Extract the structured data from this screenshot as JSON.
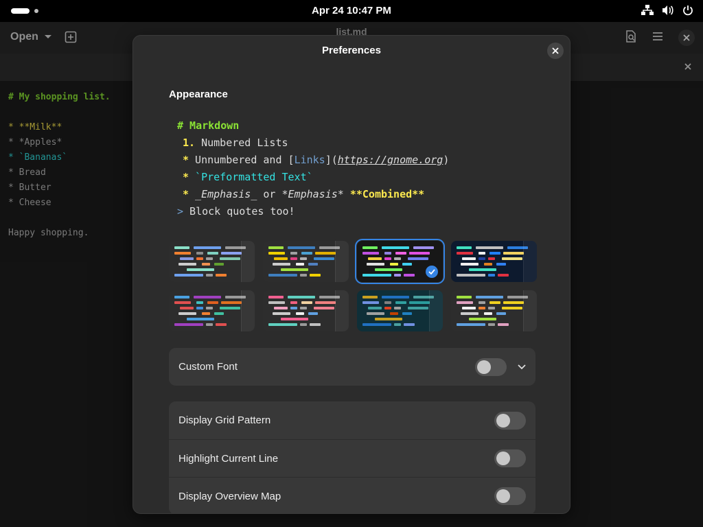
{
  "topbar": {
    "clock": "Apr 24  10:47 PM",
    "tray_icons": [
      "network-icon",
      "volume-icon",
      "power-icon"
    ]
  },
  "window": {
    "title": "list.md",
    "open_label": "Open"
  },
  "editor": {
    "lines": [
      {
        "text": "# My shopping list.",
        "color": "#8ae234",
        "bold": true
      },
      {
        "text": "",
        "color": "#ccc"
      },
      {
        "text": "* **Milk**",
        "color": "#fce94f"
      },
      {
        "text": "* *Apples*",
        "color": "#bbb"
      },
      {
        "text": "* `Bananas`",
        "color": "#34e2e2"
      },
      {
        "text": "* Bread",
        "color": "#bbb"
      },
      {
        "text": "* Butter",
        "color": "#bbb"
      },
      {
        "text": "* Cheese",
        "color": "#bbb"
      },
      {
        "text": "",
        "color": "#ccc"
      },
      {
        "text": "Happy shopping.",
        "color": "#bbb"
      }
    ]
  },
  "dialog": {
    "title": "Preferences",
    "section_appearance": "Appearance",
    "preview": {
      "l1_a": "# Markdown",
      "l2_num": "1.",
      "l2_text": " Numbered Lists",
      "l3_star": "*",
      "l3_a": " Unnumbered and ",
      "l3_b": "[",
      "l3_c": "Links",
      "l3_d": "](",
      "l3_e": "https://gnome.org",
      "l3_f": ")",
      "l4_star": "*",
      "l4_a": " `Preformatted Text`",
      "l5_star": "*",
      "l5_a": " _Emphasis_",
      "l5_b": " or ",
      "l5_c": "*Emphasis*",
      "l5_d": " ",
      "l5_e": "**Combined**",
      "l6_gt": ">",
      "l6_a": " Block quotes too!"
    },
    "schemes": [
      {
        "bg": "#2d2d2d",
        "gutter": true,
        "colors": [
          "#8ae0c8",
          "#6ea0ee",
          "#9a9a9a",
          "#f08030",
          "#8c8c8c",
          "#7fd0c0",
          "#8aa0f0",
          "#8898e0",
          "#f07030",
          "#a0a0a0",
          "#80c8b0",
          "#ccc",
          "#f09050",
          "#60a030"
        ],
        "selected": false
      },
      {
        "bg": "#2d2d2d",
        "gutter": true,
        "colors": [
          "#a0e040",
          "#3e7ebe",
          "#9a9a9a",
          "#f0d000",
          "#a0a0a0",
          "#4aa0d0",
          "#e0b000",
          "#f0c000",
          "#e04080",
          "#b0b0b0",
          "#3a8ad0",
          "#ccc",
          "#f0f0f0",
          "#5080c0"
        ],
        "selected": false
      },
      {
        "bg": "#171717",
        "gutter": false,
        "colors": [
          "#70f060",
          "#40d8e8",
          "#a090f0",
          "#c050e0",
          "#9080e0",
          "#f060e0",
          "#e050e0",
          "#f0d040",
          "#e040d0",
          "#b0b0b0",
          "#7080f0",
          "#e0e0e0",
          "#f0f040",
          "#40d0f0"
        ],
        "selected": true
      },
      {
        "bg": "#0d1a2e",
        "gutter": true,
        "colors": [
          "#40e0c0",
          "#c0c0c0",
          "#2b7fe0",
          "#e03040",
          "#f0f0f0",
          "#2080ff",
          "#f0d060",
          "#f0f0f0",
          "#2040a0",
          "#e03040",
          "#f0e080",
          "#f0f0f0",
          "#e08020",
          "#3080f0"
        ],
        "selected": false
      },
      {
        "bg": "#2d2d2d",
        "gutter": true,
        "colors": [
          "#4aa0e0",
          "#a040c0",
          "#9a9a9a",
          "#e05050",
          "#40c0c0",
          "#e06020",
          "#e07020",
          "#e05050",
          "#4090e0",
          "#a0a0a0",
          "#40c0a0",
          "#ccc",
          "#f08030",
          "#40c0a0"
        ],
        "selected": false
      },
      {
        "bg": "#2d2d2d",
        "gutter": true,
        "colors": [
          "#f06090",
          "#60d0c0",
          "#9a9a9a",
          "#c0c0c0",
          "#f06080",
          "#f0d0a0",
          "#f08080",
          "#f0a0c0",
          "#60a0e0",
          "#a0a0a0",
          "#f08090",
          "#ccc",
          "#f0f0f0",
          "#60a0e0"
        ],
        "selected": false
      },
      {
        "bg": "#0f2f38",
        "gutter": true,
        "colors": [
          "#c8a020",
          "#2070c0",
          "#4aa0a0",
          "#7090e0",
          "#808080",
          "#30a0a0",
          "#2a9c9c",
          "#40a0a0",
          "#e04020",
          "#a0a0a0",
          "#40a0a0",
          "#a0a0a0",
          "#c04000",
          "#2080c0"
        ],
        "selected": false
      },
      {
        "bg": "#2d2d2d",
        "gutter": true,
        "colors": [
          "#a0e040",
          "#60a0e0",
          "#9a9a9a",
          "#e0a0c0",
          "#a0a0a0",
          "#f0d020",
          "#f0d020",
          "#f0f0f0",
          "#f08030",
          "#a0a0a0",
          "#f0d020",
          "#ccc",
          "#f0f0f0",
          "#60a0e0"
        ],
        "selected": false
      }
    ],
    "custom_font": {
      "label": "Custom Font",
      "enabled": false
    },
    "options": [
      {
        "label": "Display Grid Pattern",
        "enabled": false
      },
      {
        "label": "Highlight Current Line",
        "enabled": false
      },
      {
        "label": "Display Overview Map",
        "enabled": false
      }
    ]
  }
}
